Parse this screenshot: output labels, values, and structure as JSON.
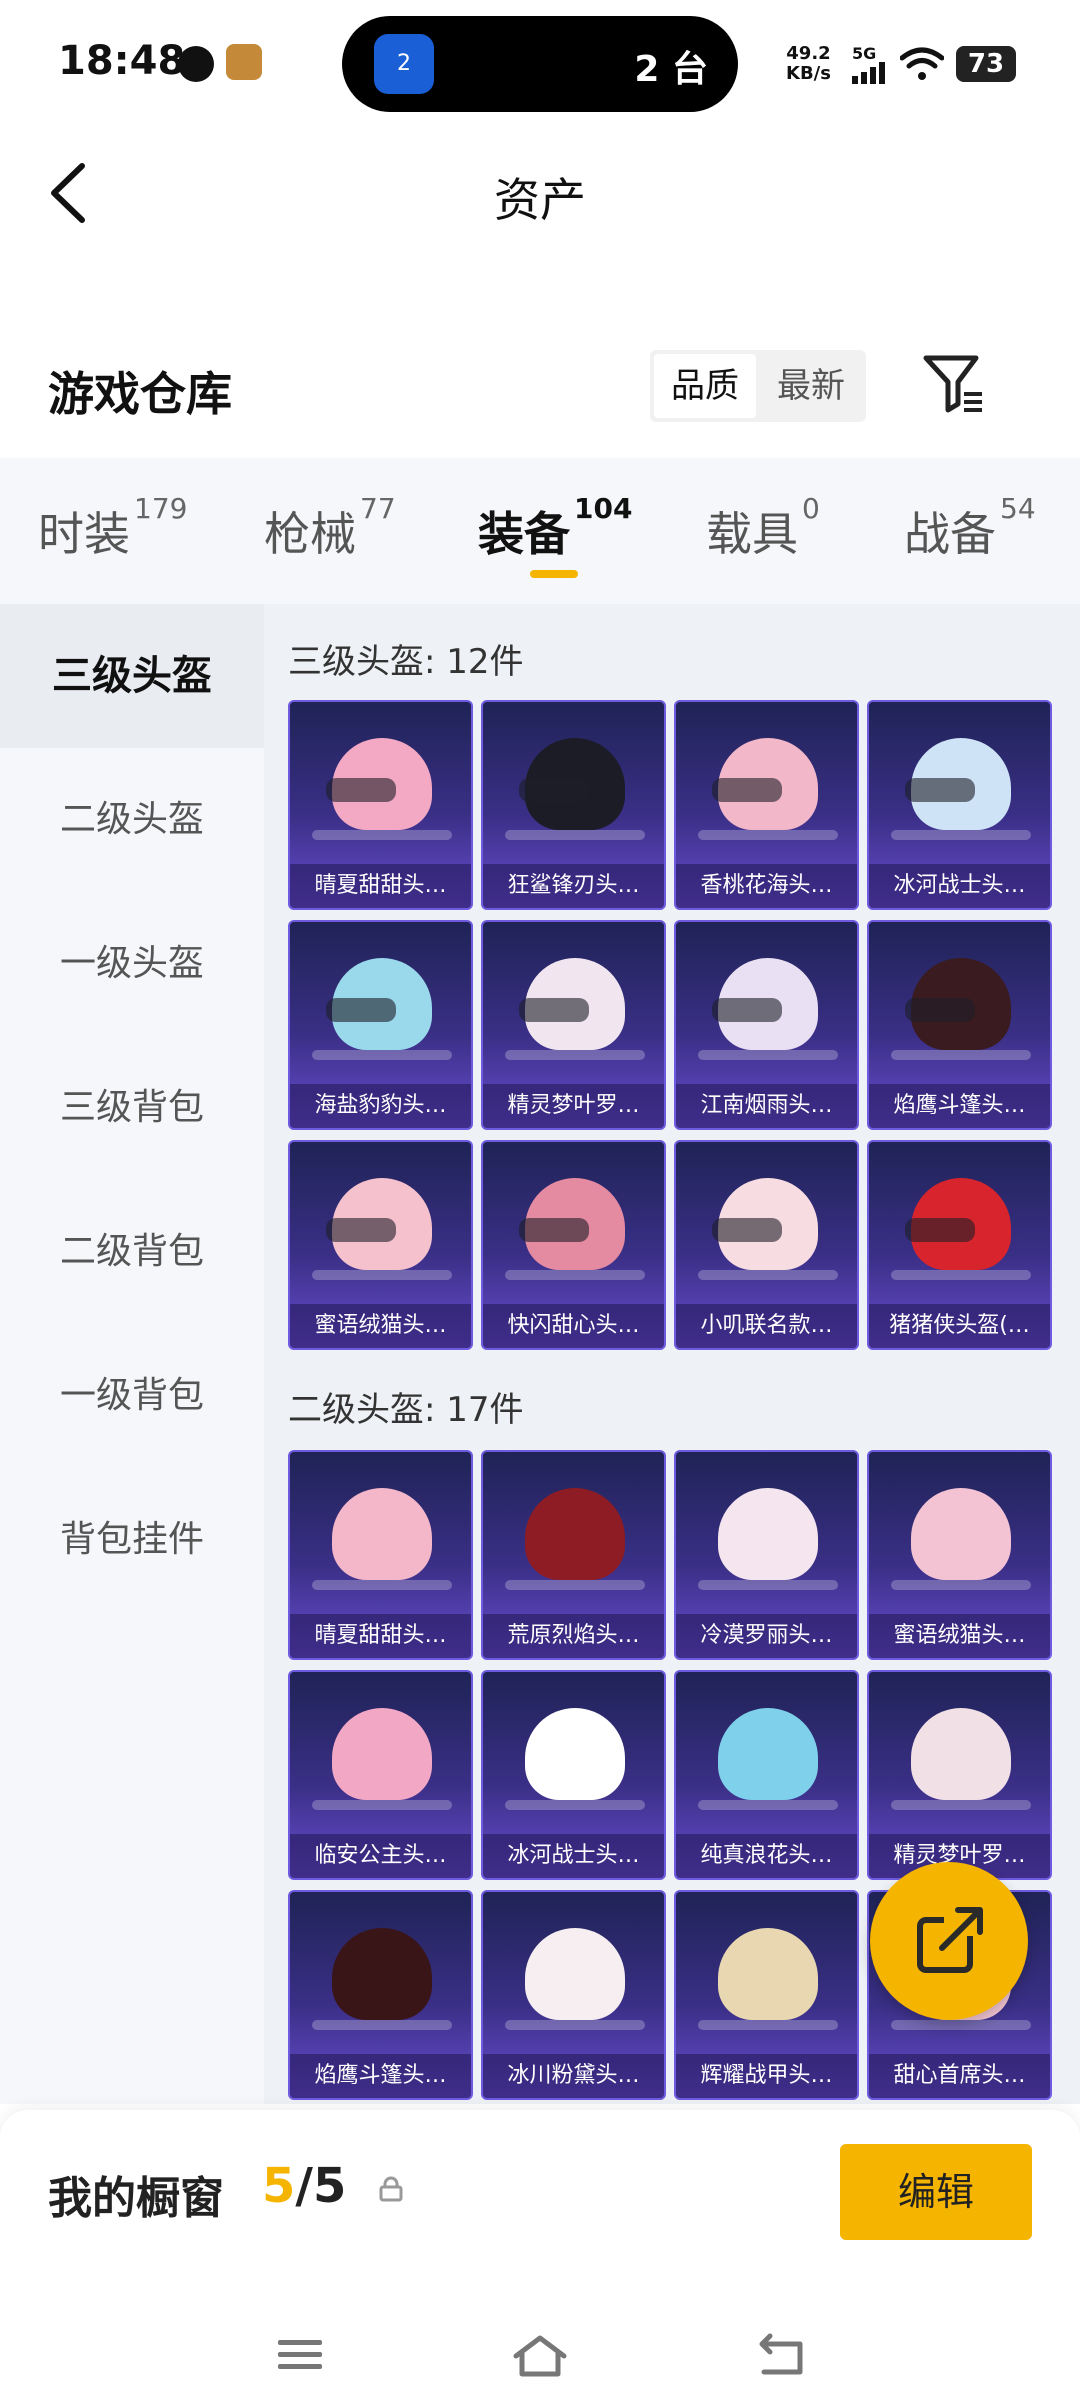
{
  "status": {
    "time": "18:48",
    "island_badge": "2",
    "island_text": "2 台",
    "net_speed": "49.2",
    "net_unit": "KB/s",
    "network": "5G",
    "battery": "73"
  },
  "header": {
    "title": "资产"
  },
  "warehouse": {
    "title": "游戏仓库",
    "sort_options": [
      "品质",
      "最新"
    ]
  },
  "tabs": [
    {
      "label": "时装",
      "count": "179"
    },
    {
      "label": "枪械",
      "count": "77"
    },
    {
      "label": "装备",
      "count": "104"
    },
    {
      "label": "载具",
      "count": "0"
    },
    {
      "label": "战备",
      "count": "54"
    }
  ],
  "sidenav": [
    "三级头盔",
    "二级头盔",
    "一级头盔",
    "三级背包",
    "二级背包",
    "一级背包",
    "背包挂件"
  ],
  "groups": [
    {
      "title": "三级头盔: 12件",
      "items": [
        "晴夏甜甜头…",
        "狂鲨锋刃头…",
        "香桃花海头…",
        "冰河战士头…",
        "海盐豹豹头…",
        "精灵梦叶罗…",
        "江南烟雨头…",
        "焰鹰斗篷头…",
        "蜜语绒猫头…",
        "快闪甜心头…",
        "小叽联名款…",
        "猪猪侠头盔(…"
      ]
    },
    {
      "title": "二级头盔: 17件",
      "items": [
        "晴夏甜甜头…",
        "荒原烈焰头…",
        "冷漠罗丽头…",
        "蜜语绒猫头…",
        "临安公主头…",
        "冰河战士头…",
        "纯真浪花头…",
        "精灵梦叶罗…",
        "焰鹰斗篷头…",
        "冰川粉黛头…",
        "辉耀战甲头…",
        "甜心首席头…"
      ]
    }
  ],
  "helmet_colors": [
    [
      "#f3a9c4",
      "#1c1c26",
      "#f2b7c8",
      "#cfe3f7",
      "#9ad8ec",
      "#f1e6f0",
      "#e9e1f3",
      "#3a1b1f",
      "#f5c1cc",
      "#e48aa1",
      "#f7dde2",
      "#d8242c"
    ],
    [
      "#f4b6c9",
      "#8e1c24",
      "#f4e5ee",
      "#f3c3d3",
      "#f2a7c4",
      "#ffffff",
      "#7fd0ea",
      "#f1e1e6",
      "#3a1518",
      "#f7eef1",
      "#e8d7b0",
      "#f4c6d4"
    ]
  ],
  "bottom": {
    "showcase_label": "我的橱窗",
    "showcase_current": "5",
    "showcase_total": "/5",
    "edit_label": "编辑"
  },
  "accent": "#f5b400"
}
